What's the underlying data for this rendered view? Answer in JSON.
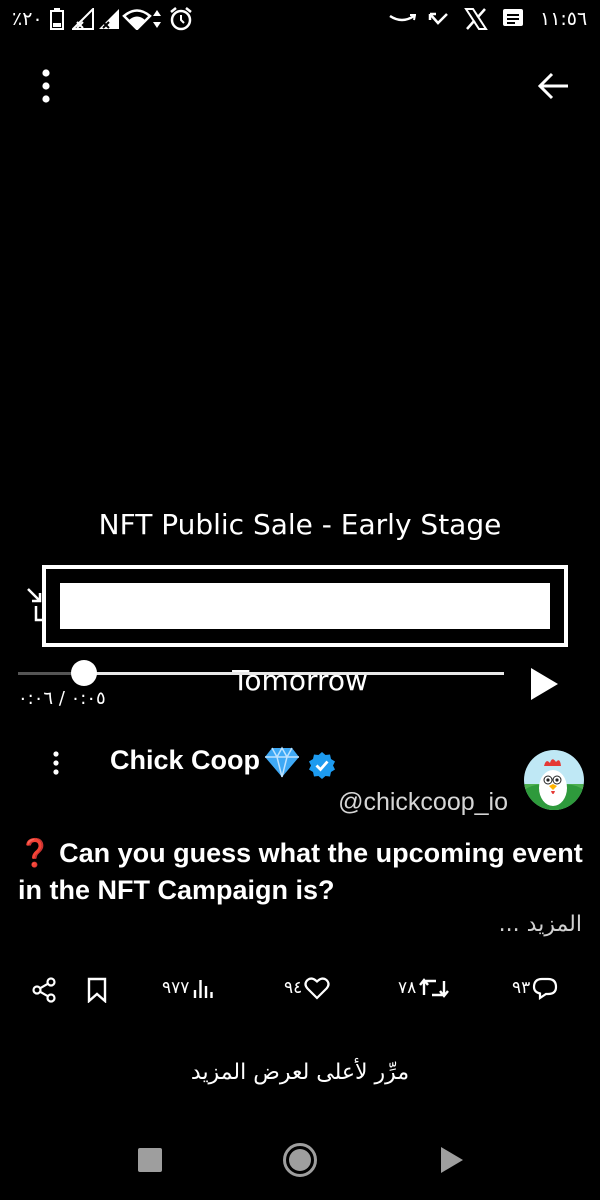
{
  "status_bar": {
    "time": "١١:٥٦",
    "battery": "٪٢٠"
  },
  "top_bar": {
    "back_icon": "arrow-left-icon",
    "menu_icon": "more-vertical-icon"
  },
  "video": {
    "title": "NFT Public Sale - Early Stage",
    "subtitle": "Tomorrow",
    "time_current": "٠:٠٥",
    "time_total": "٠:٠٦",
    "time_separator": "/",
    "progress": 0.14
  },
  "tweet": {
    "author": "Chick Coop",
    "handle": "@chickcoop_io",
    "text_line1": "❓ Can you guess what the upcoming event",
    "text_line2": "in the NFT Campaign is?",
    "more_label": "... المزيد",
    "verified_color": "#1d9bf0"
  },
  "actions": {
    "views": "٩٧٧",
    "likes": "٩٤",
    "retweets": "٧٨",
    "replies": "٩٣"
  },
  "hint": "مرِّر لأعلى لعرض المزيد",
  "colors": {
    "background": "#000000",
    "text": "#ffffff",
    "verified": "#1d9bf0",
    "diamond": "#3fa9f5"
  }
}
